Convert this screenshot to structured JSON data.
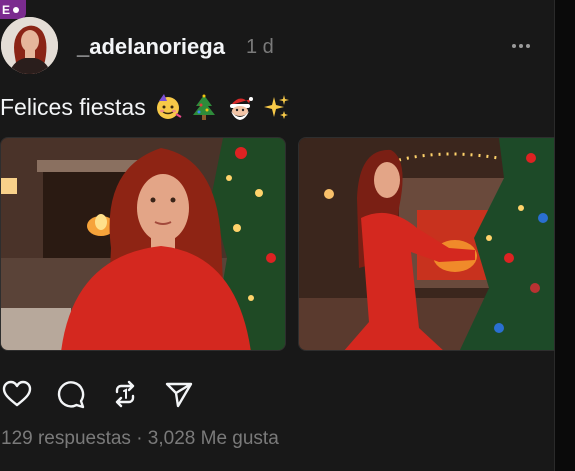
{
  "badge": {
    "label": "E"
  },
  "post": {
    "username": "_adelanoriega",
    "time": "1 d",
    "caption": "Felices fiestas",
    "caption_emojis": [
      "party-face-emoji",
      "christmas-tree-emoji",
      "santa-emoji",
      "sparkles-emoji"
    ],
    "images": [
      {
        "alt": "Mujer pelirroja con vestido rojo junto a un árbol de Navidad"
      },
      {
        "alt": "Mujer con vestido rojo decorando un árbol de Navidad"
      }
    ]
  },
  "actions": [
    "like",
    "reply",
    "repost",
    "share"
  ],
  "stats": {
    "text": "129 respuestas · 3,028 Me gusta"
  },
  "colors": {
    "background": "#181818",
    "text": "#f3f5f7",
    "muted": "#7a7a7a",
    "dress": "#d4281f"
  }
}
